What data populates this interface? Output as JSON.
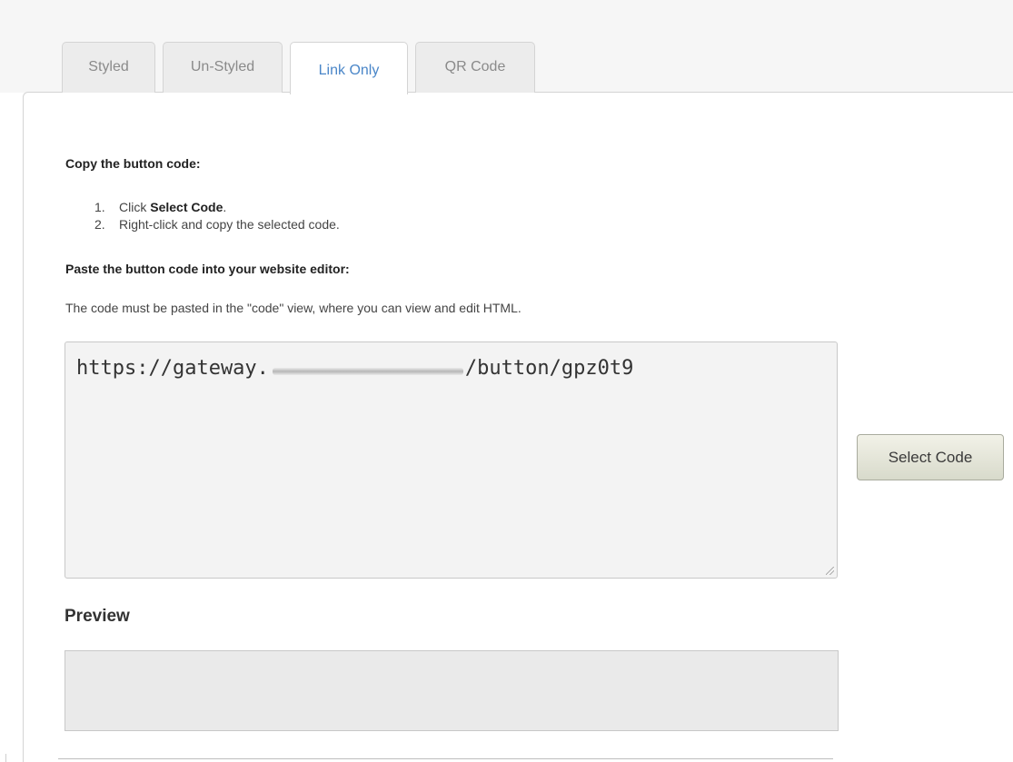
{
  "tabs": [
    {
      "label": "Styled",
      "active": false
    },
    {
      "label": "Un-Styled",
      "active": false
    },
    {
      "label": "Link Only",
      "active": true
    },
    {
      "label": "QR Code",
      "active": false
    }
  ],
  "instructions": {
    "copy_heading": "Copy the button code:",
    "steps": [
      {
        "number": "1.",
        "prefix": "Click ",
        "bold": "Select Code",
        "suffix": "."
      },
      {
        "number": "2.",
        "text": "Right-click and copy the selected code."
      }
    ],
    "paste_heading": "Paste the button code into your website editor:",
    "note": "The code must be pasted in the \"code\" view, where you can view and edit HTML."
  },
  "code": {
    "prefix": "https://gateway.",
    "suffix": "/button/gpz0t9"
  },
  "select_button_label": "Select Code",
  "preview": {
    "title": "Preview"
  },
  "colors": {
    "active_tab_text": "#4a86c8",
    "inactive_tab_text": "#8a8a8a",
    "button_bg": "#e4e5d8"
  }
}
